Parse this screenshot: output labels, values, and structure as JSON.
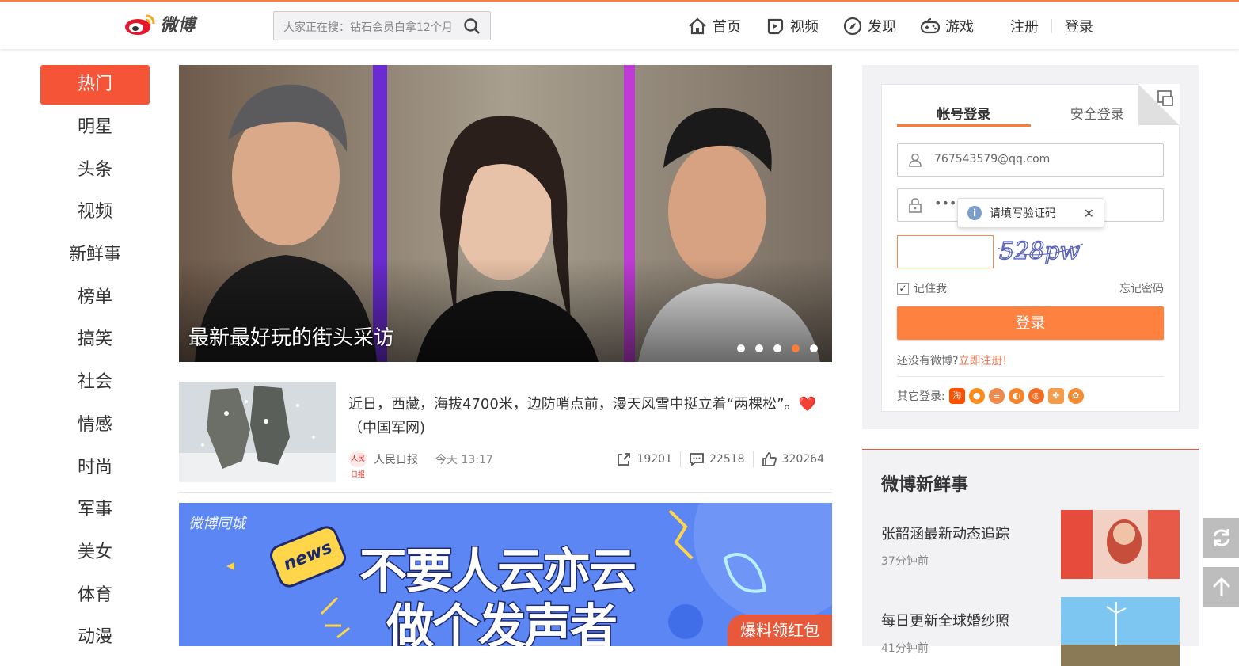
{
  "header": {
    "logo_text": "微博",
    "search_placeholder": "大家正在搜：钻石会员白拿12个月",
    "nav": [
      {
        "label": "首页",
        "icon": "home-icon"
      },
      {
        "label": "视频",
        "icon": "video-icon"
      },
      {
        "label": "发现",
        "icon": "compass-icon"
      },
      {
        "label": "游戏",
        "icon": "gamepad-icon"
      }
    ],
    "register": "注册",
    "login": "登录"
  },
  "sidebar": {
    "items": [
      "热门",
      "明星",
      "头条",
      "视频",
      "新鲜事",
      "榜单",
      "搞笑",
      "社会",
      "情感",
      "时尚",
      "军事",
      "美女",
      "体育",
      "动漫"
    ],
    "active_index": 0
  },
  "carousel": {
    "caption": "最新最好玩的街头采访",
    "dot_count": 5,
    "active_dot": 3
  },
  "feed": {
    "text": "近日，西藏，海拔4700米，边防哨点前，漫天风雪中挺立着“两棵松”。❤️（中国军网)",
    "source": "人民日报",
    "source_badge": "人民日报",
    "time": "今天 13:17",
    "reposts": "19201",
    "comments": "22518",
    "likes": "320264"
  },
  "banner": {
    "brand": "微博同城",
    "badge": "news",
    "line1": "不要人云亦云",
    "line2": "做个发声者",
    "cta": "爆料领红包"
  },
  "login": {
    "tab_account": "帐号登录",
    "tab_secure": "安全登录",
    "username": "767543579@qq.com",
    "password_mask": "•••",
    "tooltip": "请填写验证码",
    "captcha_text": "528pw",
    "remember": "记住我",
    "forgot": "忘记密码",
    "submit": "登录",
    "no_account": "还没有微博?",
    "register_link": "立即注册!",
    "other_login": "其它登录:",
    "other_login_icons": [
      "taobao-icon",
      "qq-icon",
      "sina-icon",
      "baidu-icon",
      "360-icon",
      "netease-icon",
      "paw-icon"
    ]
  },
  "fresh": {
    "title": "微博新鲜事",
    "items": [
      {
        "headline": "张韶涵最新动态追踪",
        "time": "37分钟前"
      },
      {
        "headline": "每日更新全球婚纱照",
        "time": "41分钟前"
      }
    ]
  },
  "colors": {
    "accent": "#fa7d3c",
    "active_nav": "#f65436",
    "login_button": "#ff8140",
    "link": "#eb7350"
  }
}
